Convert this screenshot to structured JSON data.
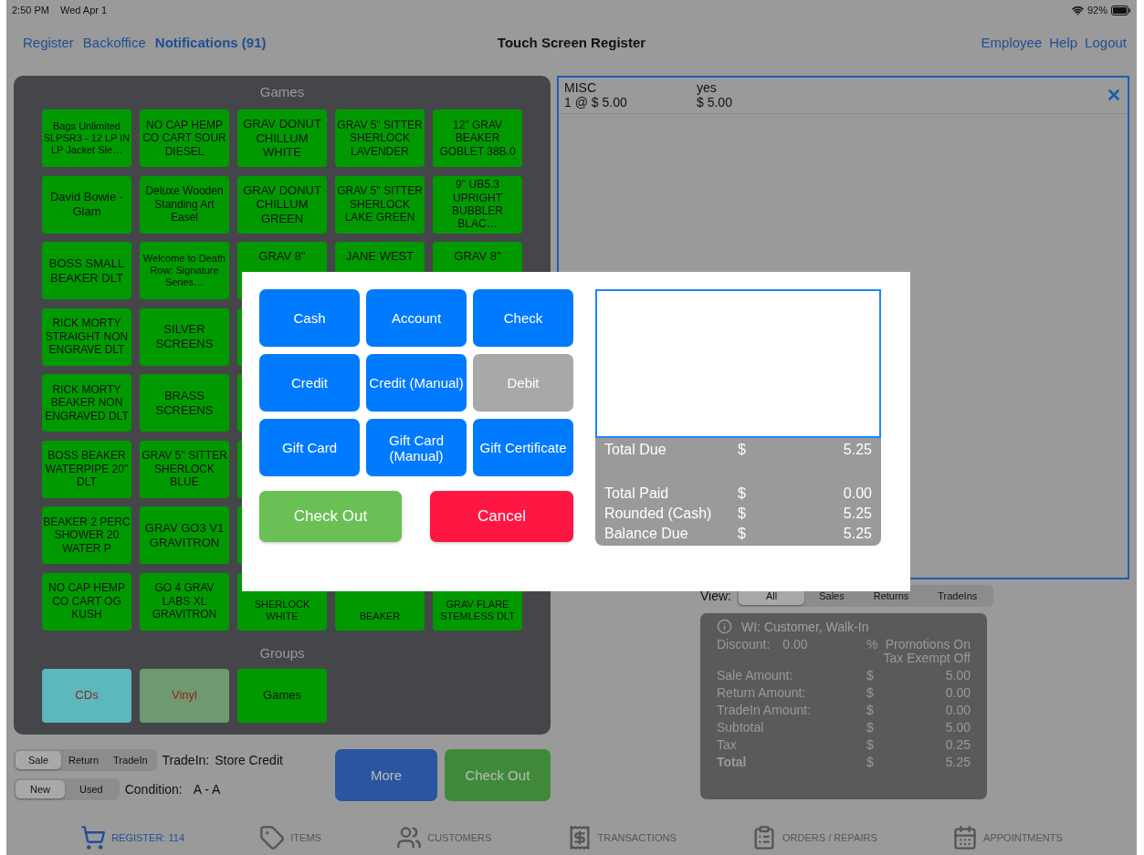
{
  "status_bar": {
    "time": "2:50 PM",
    "date": "Wed Apr 1",
    "battery": "92%"
  },
  "nav": {
    "links": [
      "Register",
      "Backoffice"
    ],
    "notifications": "Notifications (91)",
    "title": "Touch Screen Register",
    "right_links": [
      "Employee",
      "Help",
      "Logout"
    ]
  },
  "products": {
    "title": "Games",
    "tiles": [
      {
        "label": "Bags Unlimited SLPSR3 - 12 LP IN LP Jacket Sle…"
      },
      {
        "label": "NO CAP HEMP CO CART SOUR DIESEL"
      },
      {
        "label": "GRAV DONUT CHILLUM WHITE"
      },
      {
        "label": "GRAV 5\" SITTER SHERLOCK LAVENDER"
      },
      {
        "label": "12\" GRAV BEAKER GOBLET 38B.0"
      },
      {
        "label": "David Bowie - Glam"
      },
      {
        "label": "Deluxe Wooden Standing Art Easel"
      },
      {
        "label": "GRAV DONUT CHILLUM GREEN"
      },
      {
        "label": "GRAV 5'' SITTER SHERLOCK LAKE GREEN"
      },
      {
        "label": "9'' UB5.3 UPRIGHT BUBBLER  BLAC…"
      },
      {
        "label": "BOSS SMALL BEAKER DLT"
      },
      {
        "label": "Welcome to Death Row: Signature Series…"
      },
      {
        "label": "GRAV 8\"",
        "kind": "cut_bottom"
      },
      {
        "label": "JANE WEST",
        "kind": "cut_bottom"
      },
      {
        "label": "GRAV 8\"",
        "kind": "cut_bottom"
      },
      {
        "label": "RICK MORTY STRAIGHT NON ENGRAVE DLT"
      },
      {
        "label": "SILVER SCREENS"
      },
      {
        "kind": "covered"
      },
      {
        "kind": "absent"
      },
      {
        "kind": "absent"
      },
      {
        "label": "RICK MORTY BEAKER NON ENGRAVED DLT"
      },
      {
        "label": "BRASS SCREENS"
      },
      {
        "kind": "covered"
      },
      {
        "kind": "absent"
      },
      {
        "kind": "absent"
      },
      {
        "label": "BOSS BEAKER WATERPIPE 20\" DLT"
      },
      {
        "label": "GRAV 5'' SITTER SHERLOCK BLUE"
      },
      {
        "kind": "covered"
      },
      {
        "kind": "absent"
      },
      {
        "kind": "absent"
      },
      {
        "label": "BEAKER 2 PERC SHOWER 20 WATER P"
      },
      {
        "label": "GRAV GO3 V1 GRAVITRON"
      },
      {
        "kind": "covered"
      },
      {
        "kind": "absent"
      },
      {
        "kind": "absent"
      },
      {
        "label": "NO CAP HEMP CO CART OG KUSH"
      },
      {
        "label": "GO 4 GRAV LABS  XL GRAVITRON"
      },
      {
        "label": "SHERLOCK WHITE",
        "kind": "cut_top"
      },
      {
        "label": "BEAKER",
        "kind": "cut_top"
      },
      {
        "label": "GRAV FLARE STEMLESS DLT",
        "kind": "cut_top"
      }
    ]
  },
  "groups": {
    "title": "Groups",
    "items": [
      {
        "label": "CDs",
        "color": "#5bb8bd",
        "selected": false
      },
      {
        "label": "Vinyl",
        "color": "#6f9a6f",
        "selected": false
      },
      {
        "label": "Games",
        "color": "#009a00",
        "selected": true
      }
    ]
  },
  "mode": {
    "options": [
      {
        "label": "Sale",
        "selected": true
      },
      {
        "label": "Return",
        "selected": false
      },
      {
        "label": "TradeIn",
        "selected": false
      }
    ],
    "tradein_label": "TradeIn:",
    "tradein_value": "Store Credit"
  },
  "condition_toggle": {
    "options": [
      {
        "label": "New",
        "selected": true
      },
      {
        "label": "Used",
        "selected": false
      }
    ],
    "label": "Condition:",
    "value": "A - A"
  },
  "actions": {
    "more": "More",
    "checkout": "Check Out"
  },
  "cart": {
    "lines": [
      {
        "name": "MISC",
        "taxable": "yes",
        "qty_price": "1 @ $ 5.00",
        "total": "$ 5.00"
      }
    ]
  },
  "view": {
    "label": "View:",
    "options": [
      {
        "label": "All",
        "selected": true
      },
      {
        "label": "Sales",
        "selected": false
      },
      {
        "label": "Returns",
        "selected": false
      },
      {
        "label": "TradeIns",
        "selected": false
      }
    ]
  },
  "summary": {
    "customer": "WI: Customer, Walk-In",
    "discount_label": "Discount:",
    "discount": "0.00",
    "percent": "%",
    "promotions": "Promotions On",
    "tax_exempt": "Tax Exempt Off",
    "rows": [
      {
        "label": "Sale Amount:",
        "currency": "$",
        "value": "5.00",
        "bold": false
      },
      {
        "label": "Return Amount:",
        "currency": "$",
        "value": "0.00",
        "bold": false
      },
      {
        "label": "TradeIn  Amount:",
        "currency": "$",
        "value": "0.00",
        "bold": false
      },
      {
        "label": "Subtotal",
        "currency": "$",
        "value": "5.00",
        "bold": false
      },
      {
        "label": "Tax",
        "currency": "$",
        "value": "0.25",
        "bold": false
      },
      {
        "label": "Total",
        "currency": "$",
        "value": "5.25",
        "bold": true
      }
    ]
  },
  "tab_bar": [
    {
      "label": "REGISTER: 114",
      "kind": "cart",
      "selected": true
    },
    {
      "label": "ITEMS",
      "kind": "tag",
      "selected": false
    },
    {
      "label": "CUSTOMERS",
      "kind": "people",
      "selected": false
    },
    {
      "label": "TRANSACTIONS",
      "kind": "receipt",
      "selected": false
    },
    {
      "label": "ORDERS / REPAIRS",
      "kind": "clipboard",
      "selected": false
    },
    {
      "label": "APPOINTMENTS",
      "kind": "calendar",
      "selected": false
    }
  ],
  "payment_dialog": {
    "methods": [
      {
        "label": "Cash",
        "disabled": false
      },
      {
        "label": "Account",
        "disabled": false
      },
      {
        "label": "Check",
        "disabled": false
      },
      {
        "label": "Credit",
        "disabled": false
      },
      {
        "label": "Credit (Manual)",
        "disabled": false
      },
      {
        "label": "Debit",
        "disabled": true
      },
      {
        "label": "Gift Card",
        "disabled": false
      },
      {
        "label": "Gift Card (Manual)",
        "disabled": false
      },
      {
        "label": "Gift Certificate",
        "disabled": false
      }
    ],
    "checkout": "Check Out",
    "cancel": "Cancel",
    "total_due": {
      "label": "Total Due",
      "currency": "$",
      "value": "5.25"
    },
    "totals": [
      {
        "label": "Total Paid",
        "currency": "$",
        "value": "0.00"
      },
      {
        "label": "Rounded (Cash)",
        "currency": "$",
        "value": "5.25"
      },
      {
        "label": "Balance Due",
        "currency": "$",
        "value": "5.25"
      }
    ]
  }
}
